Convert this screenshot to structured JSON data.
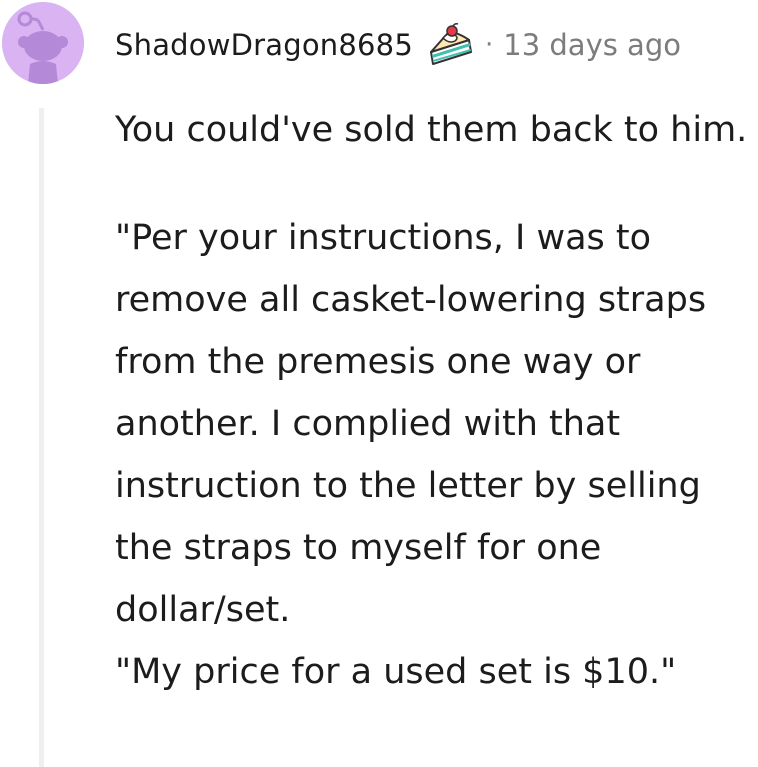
{
  "comment": {
    "author": "ShadowDragon8685",
    "separator": "·",
    "timestamp": "13 days ago",
    "flair_icon": "cake-slice-icon",
    "avatar_icon": "reddit-snoo-avatar-icon",
    "paragraphs": [
      "You could've sold them back to him.",
      "\"Per your instructions, I was to remove all casket-lowering straps from the premesis one way or another. I complied with that instruction to the letter by selling the straps to myself for one dollar/set.",
      "\"My price for a used set is $10.\""
    ]
  },
  "colors": {
    "avatar_background": "#d9b3f2",
    "avatar_figure": "#b48ad8",
    "text": "#1c1c1c",
    "meta_text": "#7c7c7c",
    "thread_line": "#edeff1"
  }
}
